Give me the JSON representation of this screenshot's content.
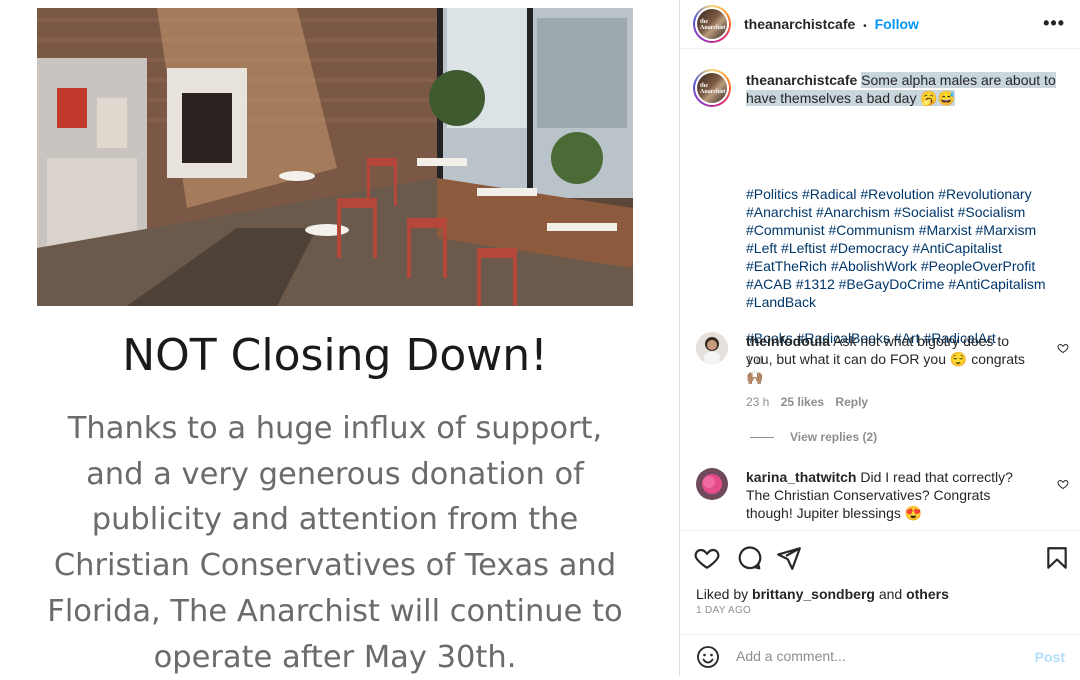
{
  "post": {
    "image_alt": "cafe interior",
    "headline": "NOT Closing Down!",
    "body": "Thanks to a huge influx of support, and a very generous donation of publicity and attention from the Christian Conservatives of Texas and Florida, The Anarchist will continue to operate after May 30th."
  },
  "header": {
    "avatar_text": "the Anarchist",
    "username": "theanarchistcafe",
    "separator": "•",
    "follow_label": "Follow",
    "more_label": "•••"
  },
  "caption": {
    "username": "theanarchistcafe",
    "text": "Some alpha males are about to have themselves a bad day",
    "emoji": "🥱😅",
    "hashtags": "#Politics #Radical #Revolution #Revolutionary #Anarchist #Anarchism #Socialist #Socialism #Communist #Communism #Marxist #Marxism #Left #Leftist #Democracy #AntiCapitalist #EatTheRich #AbolishWork #PeopleOverProfit #ACAB #1312 #BeGayDoCrime #AntiCapitalism #LandBack",
    "hashtags2": "#Books #RadicalBooks #Art #RadicalArt",
    "age": "1 d"
  },
  "comments": [
    {
      "username": "theinfodoula",
      "text": "Ask not what bigotry does to you, but what it can do FOR you 😌 congrats 🙌🏽",
      "time": "23 h",
      "likes": "25 likes",
      "reply_label": "Reply",
      "view_replies": "View replies (2)"
    },
    {
      "username": "karina_thatwitch",
      "text": "Did I read that correctly? The Christian Conservatives? Congrats though! Jupiter blessings 😍"
    }
  ],
  "footer": {
    "liked_prefix": "Liked by",
    "liked_user": "brittany_sondberg",
    "liked_and": "and",
    "liked_others": "others",
    "time_ago": "1 DAY AGO",
    "comment_placeholder": "Add a comment...",
    "post_label": "Post"
  },
  "colors": {
    "link_blue": "#0095f6",
    "hashtag_blue": "#00376b",
    "highlight": "#c9d7dd",
    "post_disabled": "#b2dffc"
  }
}
